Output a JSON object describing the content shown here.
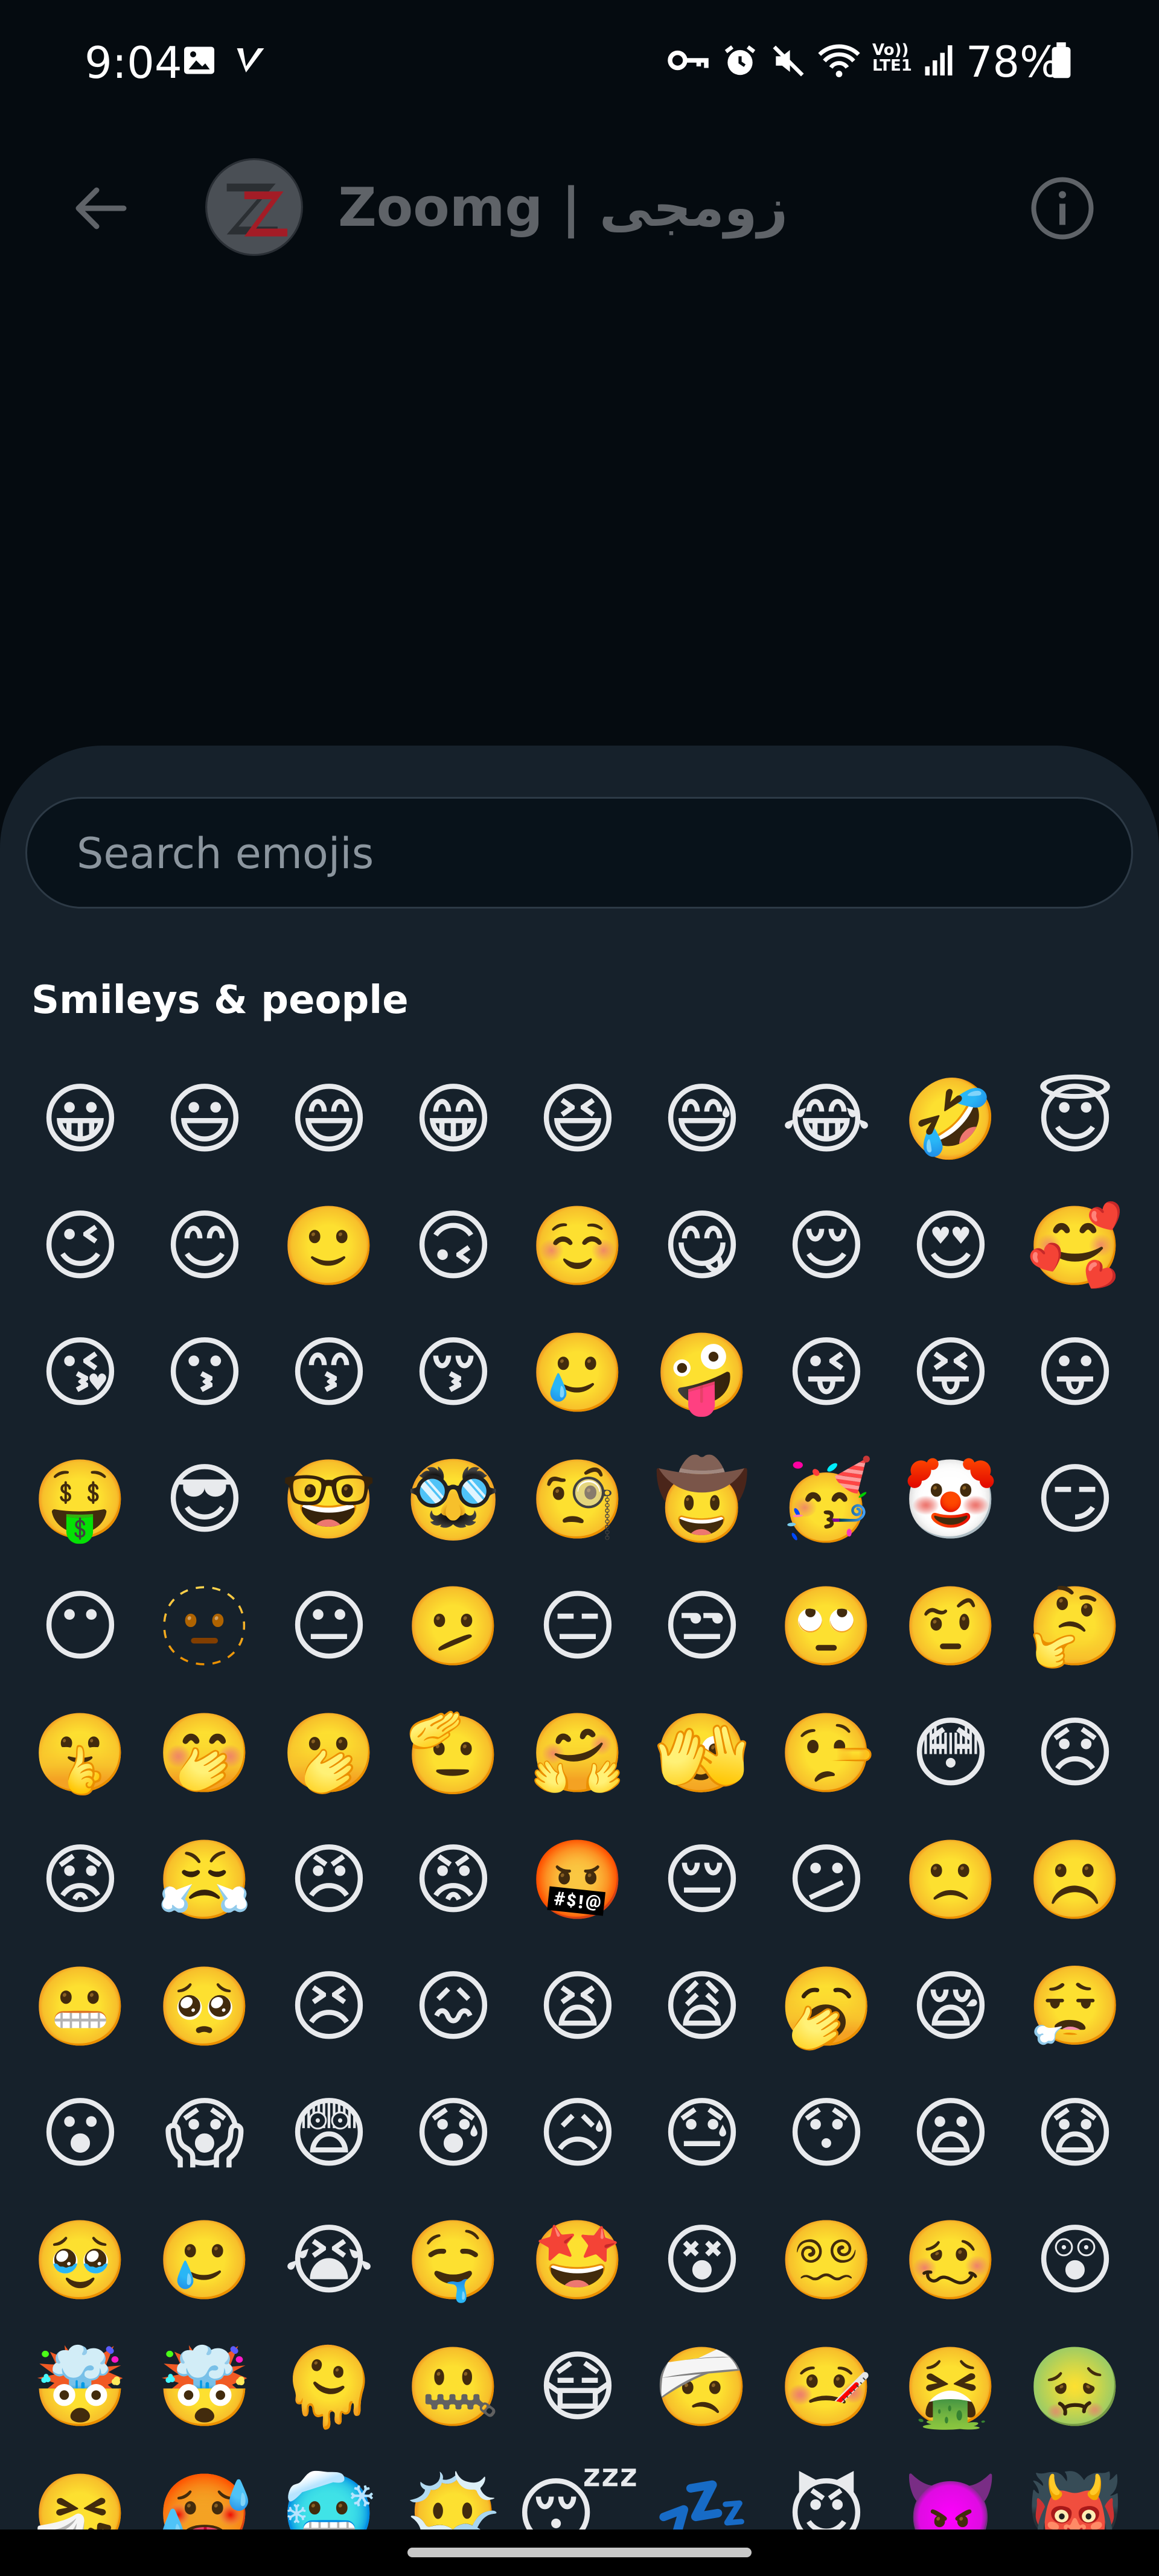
{
  "status_bar": {
    "time": "9:04",
    "battery": "78%",
    "icons": [
      "image-icon",
      "v-app-icon",
      "key-icon",
      "alarm-icon",
      "mute-icon",
      "wifi-icon",
      "volte-icon",
      "signal-icon",
      "battery-icon"
    ]
  },
  "header": {
    "title": "Zoomg | زومجی",
    "back_icon": "back-arrow-icon",
    "info_icon": "info-icon"
  },
  "emoji_picker": {
    "search_placeholder": "Search emojis",
    "section_title": "Smileys & people",
    "rows": [
      [
        "😀",
        "😃",
        "😄",
        "😁",
        "😆",
        "😅",
        "😂",
        "🤣",
        "😇"
      ],
      [
        "😉",
        "😊",
        "🙂",
        "🙃",
        "☺️",
        "😋",
        "😌",
        "😍",
        "🥰"
      ],
      [
        "😘",
        "😗",
        "😙",
        "😚",
        "🥲",
        "🤪",
        "😜",
        "😝",
        "😛"
      ],
      [
        "🤑",
        "😎",
        "🤓",
        "🥸",
        "🧐",
        "🤠",
        "🥳",
        "🤡",
        "😏"
      ],
      [
        "😶",
        "🫥",
        "😐",
        "🫤",
        "😑",
        "😒",
        "🙄",
        "🤨",
        "🤔"
      ],
      [
        "🤫",
        "🤭",
        "🫢",
        "🫡",
        "🤗",
        "🫣",
        "🤥",
        "😳",
        "😞"
      ],
      [
        "😟",
        "😤",
        "😠",
        "😡",
        "🤬",
        "😔",
        "😕",
        "🙁",
        "☹️"
      ],
      [
        "😬",
        "🥺",
        "😣",
        "😖",
        "😫",
        "😩",
        "🥱",
        "😪",
        "😮‍💨"
      ],
      [
        "😮",
        "😱",
        "😨",
        "😰",
        "😥",
        "😓",
        "😯",
        "😦",
        "😧"
      ],
      [
        "🥹",
        "🥲",
        "😭",
        "🤤",
        "🤩",
        "😵",
        "😵‍💫",
        "🥴",
        "😲"
      ],
      [
        "🤯",
        "🤯",
        "🫠",
        "🤐",
        "😷",
        "🤕",
        "🤒",
        "🤮",
        "🤢"
      ],
      [
        "🤧",
        "🥵",
        "🥶",
        "😶‍🌫️",
        "😴",
        "💤",
        "😈",
        "👿",
        "👹"
      ]
    ]
  }
}
